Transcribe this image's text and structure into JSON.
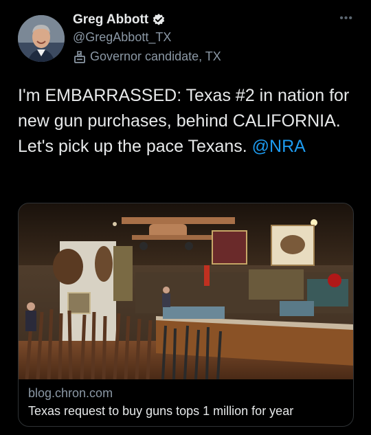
{
  "author": {
    "name": "Greg Abbott",
    "handle": "@GregAbbott_TX",
    "label": "Governor candidate, TX",
    "verified": true
  },
  "tweet": {
    "text": "I'm EMBARRASSED: Texas #2 in nation for new gun purchases, behind CALIFORNIA. Let's pick up the pace Texans. ",
    "mention": "@NRA"
  },
  "card": {
    "domain": "blog.chron.com",
    "headline": "Texas request to buy guns tops 1 million for year"
  },
  "icons": {
    "verified": "verified-badge-icon",
    "label": "ballot-box-icon",
    "more": "more-options-icon"
  },
  "colors": {
    "background": "#000000",
    "text": "#e7e9ea",
    "secondary": "#8b98a5",
    "link": "#1d9bf0"
  }
}
